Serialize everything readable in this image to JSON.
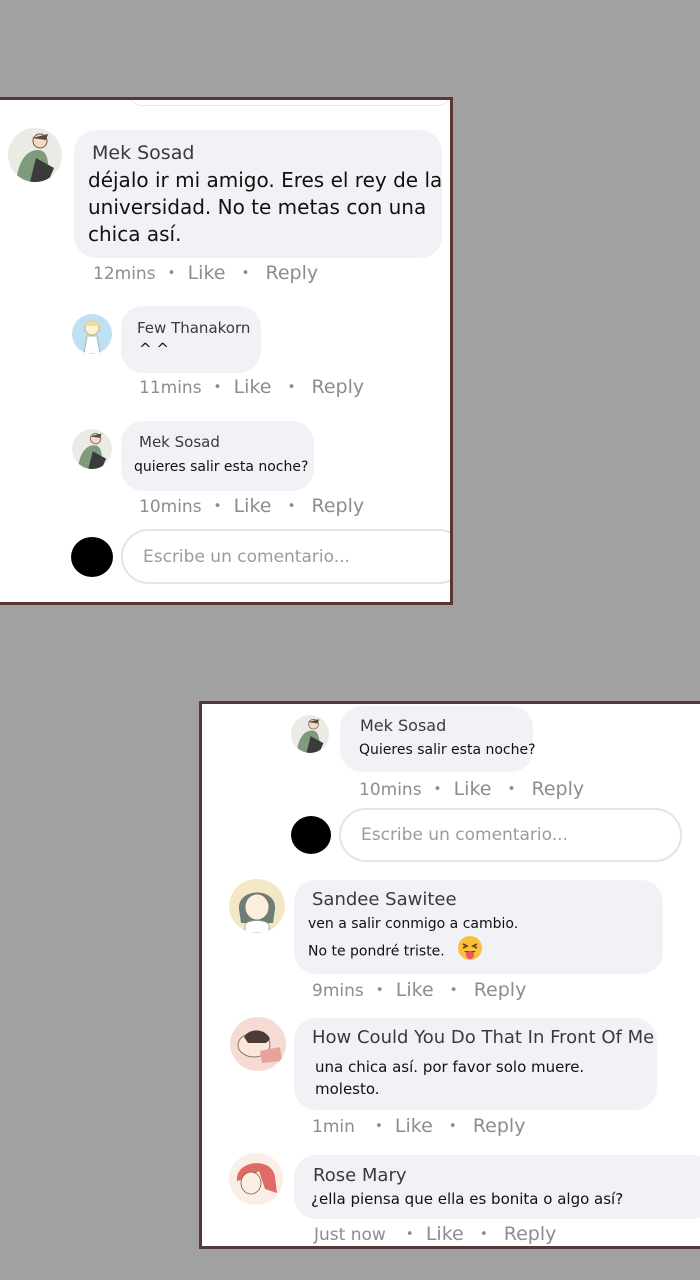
{
  "panel1": {
    "comments": [
      {
        "author": "Mek Sosad",
        "lines": [
          "déjalo ir mi amigo. Eres el rey de la",
          "universidad. No te metas con una",
          "chica así."
        ],
        "time": "12mins",
        "like": "Like",
        "reply": "Reply",
        "avatar": "mek-avatar"
      },
      {
        "author": "Few Thanakorn",
        "lines": [
          "^ ^"
        ],
        "time": "11mins",
        "like": "Like",
        "reply": "Reply",
        "avatar": "few-avatar"
      },
      {
        "author": "Mek Sosad",
        "lines": [
          "quieres salir esta noche?"
        ],
        "time": "10mins",
        "like": "Like",
        "reply": "Reply",
        "avatar": "mek-avatar"
      }
    ],
    "input_placeholder": "Escribe un comentario..."
  },
  "panel2": {
    "comments": [
      {
        "author": "Mek Sosad",
        "lines": [
          "Quieres salir esta noche?"
        ],
        "time": "10mins",
        "like": "Like",
        "reply": "Reply",
        "avatar": "mek-avatar"
      },
      {
        "author": "Sandee Sawitee",
        "lines": [
          "ven a salir conmigo a cambio.",
          "No te pondré triste."
        ],
        "time": "9mins",
        "like": "Like",
        "reply": "Reply",
        "avatar": "sandee-avatar",
        "emoji": "tongue-wink-emoji"
      },
      {
        "author": "How Could You Do That In Front Of Me",
        "lines": [
          "una chica así. por favor solo muere.",
          "molesto."
        ],
        "time": "1min",
        "like": "Like",
        "reply": "Reply",
        "avatar": "howcould-avatar"
      },
      {
        "author": "Rose Mary",
        "lines": [
          "¿ella piensa que ella es bonita o algo así?"
        ],
        "time": "Just now",
        "like": "Like",
        "reply": "Reply",
        "avatar": "rose-avatar"
      }
    ],
    "input_placeholder": "Escribe un comentario..."
  },
  "colors": {
    "background": "#a1a1a1",
    "bubble": "#f0f2f5",
    "panel_border": "#5a3636",
    "meta_text": "#8a8d91"
  }
}
